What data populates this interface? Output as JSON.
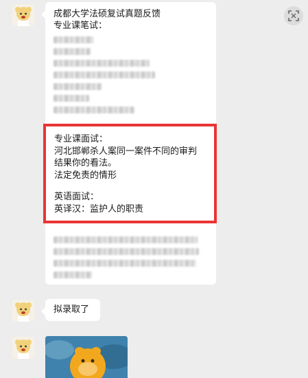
{
  "messages": [
    {
      "sender": "user-avatar",
      "title": "成都大学法硕复试真题反馈",
      "written_label": "专业课笔试：",
      "interview_label": "专业课面试：",
      "interview_q1_line1": "河北邯郸杀人案同一案件不同的审判",
      "interview_q1_line2": "结果你的看法。",
      "interview_q2": "法定免责的情形",
      "english_label": "英语面试：",
      "english_q": "英译汉：监护人的职责"
    },
    {
      "sender": "user-avatar",
      "text": "拟录取了"
    },
    {
      "sender": "user-avatar",
      "image": "cartoon-character-photo"
    }
  ],
  "colors": {
    "background": "#ededed",
    "bubble": "#ffffff",
    "highlight_border": "#ea3434"
  },
  "icons": {
    "corner": "scan-icon"
  }
}
